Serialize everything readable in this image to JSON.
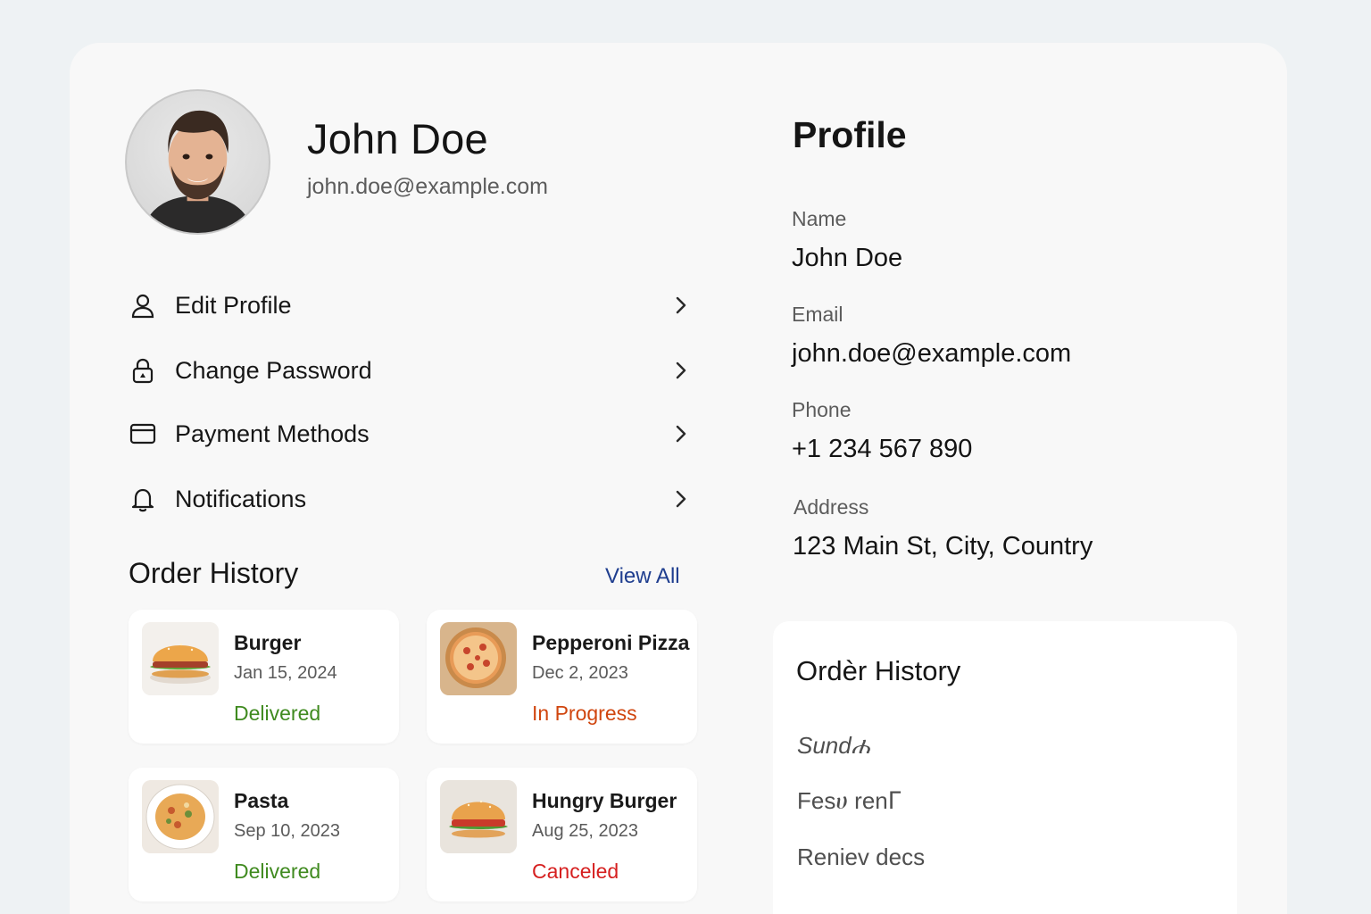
{
  "user": {
    "name": "John Doe",
    "email": "john.doe@example.com"
  },
  "menu": [
    {
      "label": "Edit Profile",
      "icon": "user-icon"
    },
    {
      "label": "Change Password",
      "icon": "lock-icon"
    },
    {
      "label": "Payment Methods",
      "icon": "credit-card-icon"
    },
    {
      "label": "Notifications",
      "icon": "bell-icon"
    }
  ],
  "order_history": {
    "title": "Order History",
    "view_all": "View All",
    "orders": [
      {
        "name": "Burger",
        "date": "Jan 15, 2024",
        "status": "Delivered",
        "status_color": "#3f8a1f",
        "thumb": "burger"
      },
      {
        "name": "Pepperoni Pizza",
        "date": "Dec 2, 2023",
        "status": "In Progress",
        "status_color": "#d0450e",
        "thumb": "pizza"
      },
      {
        "name": "Pasta",
        "date": "Sep 10, 2023",
        "status": "Delivered",
        "status_color": "#3f8a1f",
        "thumb": "pasta"
      },
      {
        "name": "Hungry Burger",
        "date": "Aug 25, 2023",
        "status": "Canceled",
        "status_color": "#d61f1f",
        "thumb": "burger"
      }
    ]
  },
  "profile": {
    "title": "Profile",
    "fields": [
      {
        "label": "Name",
        "value": "John Doe"
      },
      {
        "label": "Email",
        "value": "john.doe@example.com"
      },
      {
        "label": "Phone",
        "value": "+1 234 567 890"
      },
      {
        "label": "Address",
        "value": "123 Main St, City, Country"
      }
    ]
  },
  "order_history_panel": {
    "title": "Ordèr History",
    "lines": [
      "Sundሐ",
      "Fesሀ renᒥ",
      "Reniev decs"
    ]
  },
  "colors": {
    "link": "#1f3e8f",
    "delivered": "#3f8a1f",
    "in_progress": "#d0450e",
    "canceled": "#d61f1f",
    "card_bg": "#f8f8f8",
    "page_bg": "#eef2f4"
  }
}
